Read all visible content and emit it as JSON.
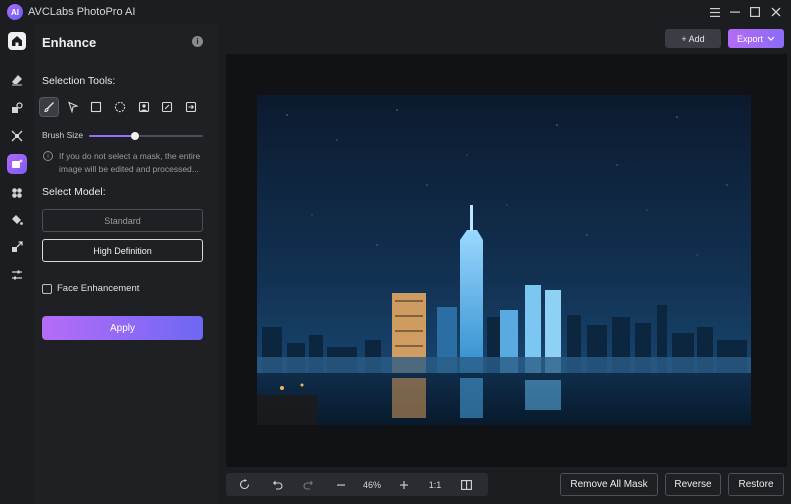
{
  "app": {
    "title": "AVCLabs PhotoPro AI",
    "logo_text": "AI"
  },
  "window": {
    "menu_icon": "hamburger-icon",
    "minimize_icon": "minimize-icon",
    "maximize_icon": "maximize-icon",
    "close_icon": "close-icon"
  },
  "rail": {
    "items": [
      "home-icon",
      "eraser-icon",
      "replace-icon",
      "crop-icon",
      "enhance-icon",
      "object-icon",
      "paint-icon",
      "upscale-icon",
      "adjust-icon"
    ],
    "active": "enhance-icon"
  },
  "panel": {
    "title": "Enhance",
    "selection_tools_label": "Selection Tools:",
    "tools": [
      "brush-icon",
      "lasso-icon",
      "rectangle-icon",
      "ellipse-icon",
      "portrait-icon",
      "auto-select-icon",
      "invert-icon"
    ],
    "brush_size_label": "Brush Size",
    "brush_size": 0.4,
    "hint_line1": "If you do not select a mask, the entire",
    "hint_line2": "image will be edited and processed...",
    "select_model_label": "Select Model:",
    "model_standard": "Standard",
    "model_hd": "High Definition",
    "selected_model": "High Definition",
    "face_enhancement_label": "Face Enhancement",
    "face_enhancement_checked": false,
    "apply_label": "Apply"
  },
  "toolbar": {
    "add_label": "+ Add",
    "export_label": "Export"
  },
  "bottom": {
    "zoom": "46%",
    "ratio": "1:1",
    "remove_mask_label": "Remove All Mask",
    "reverse_label": "Reverse",
    "restore_label": "Restore"
  },
  "colors": {
    "accent_start": "#b66cf6",
    "accent_end": "#6d68f5",
    "panel_bg": "#1e2024",
    "canvas_bg": "#101216"
  }
}
